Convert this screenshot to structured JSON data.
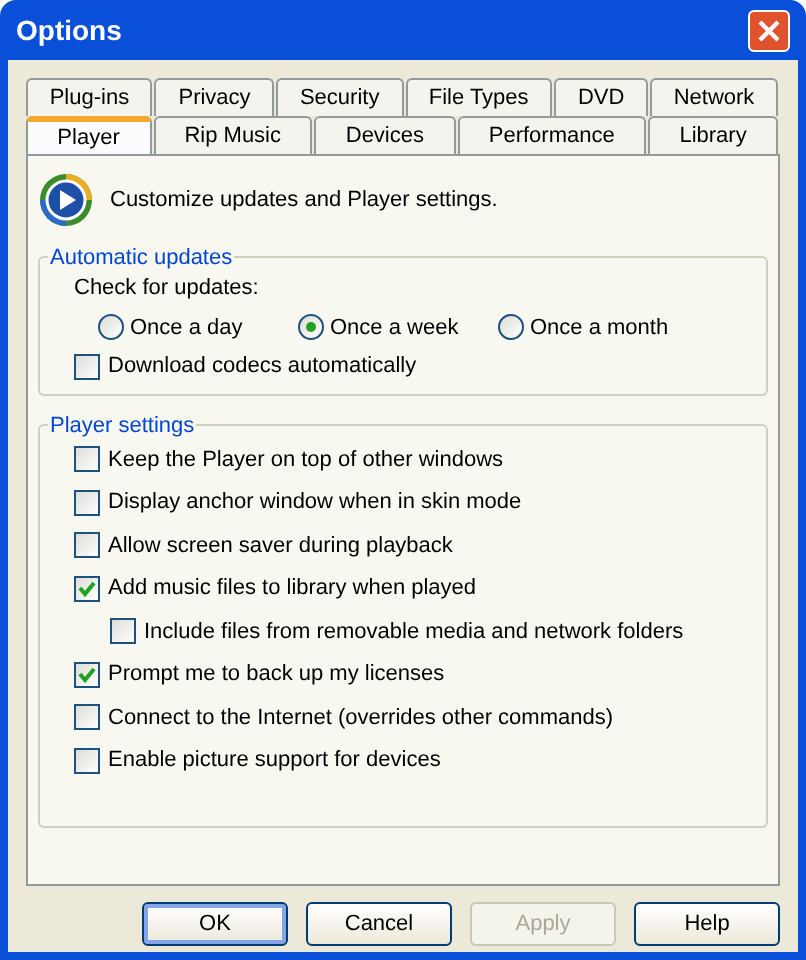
{
  "window": {
    "title": "Options"
  },
  "tab_rows": [
    [
      {
        "label": "Plug-ins",
        "selected": false
      },
      {
        "label": "Privacy",
        "selected": false
      },
      {
        "label": "Security",
        "selected": false
      },
      {
        "label": "File Types",
        "selected": false
      },
      {
        "label": "DVD",
        "selected": false
      },
      {
        "label": "Network",
        "selected": false
      }
    ],
    [
      {
        "label": "Player",
        "selected": true
      },
      {
        "label": "Rip Music",
        "selected": false
      },
      {
        "label": "Devices",
        "selected": false
      },
      {
        "label": "Performance",
        "selected": false
      },
      {
        "label": "Library",
        "selected": false
      }
    ]
  ],
  "header": "Customize updates and Player settings.",
  "automatic_updates": {
    "title": "Automatic updates",
    "label": "Check for updates:",
    "options": [
      {
        "label": "Once a day",
        "selected": false
      },
      {
        "label": "Once a week",
        "selected": true
      },
      {
        "label": "Once a month",
        "selected": false
      }
    ],
    "checkboxes": [
      {
        "label": "Download codecs automatically",
        "checked": false
      }
    ]
  },
  "player_settings": {
    "title": "Player settings",
    "checkboxes": [
      {
        "label": "Keep the Player on top of other windows",
        "checked": false
      },
      {
        "label": "Display anchor window when in skin mode",
        "checked": false
      },
      {
        "label": "Allow screen saver during playback",
        "checked": false
      },
      {
        "label": "Add music files to library when played",
        "checked": true,
        "children": [
          {
            "label": "Include files from removable media and network folders",
            "checked": false
          }
        ]
      },
      {
        "label": "Prompt me to back up my licenses",
        "checked": true
      },
      {
        "label": "Connect to the Internet (overrides other commands)",
        "checked": false
      },
      {
        "label": "Enable picture support for devices",
        "checked": false
      }
    ]
  },
  "buttons": [
    {
      "label": "OK",
      "default": true,
      "disabled": false
    },
    {
      "label": "Cancel",
      "default": false,
      "disabled": false
    },
    {
      "label": "Apply",
      "default": false,
      "disabled": true
    },
    {
      "label": "Help",
      "default": false,
      "disabled": false
    }
  ]
}
